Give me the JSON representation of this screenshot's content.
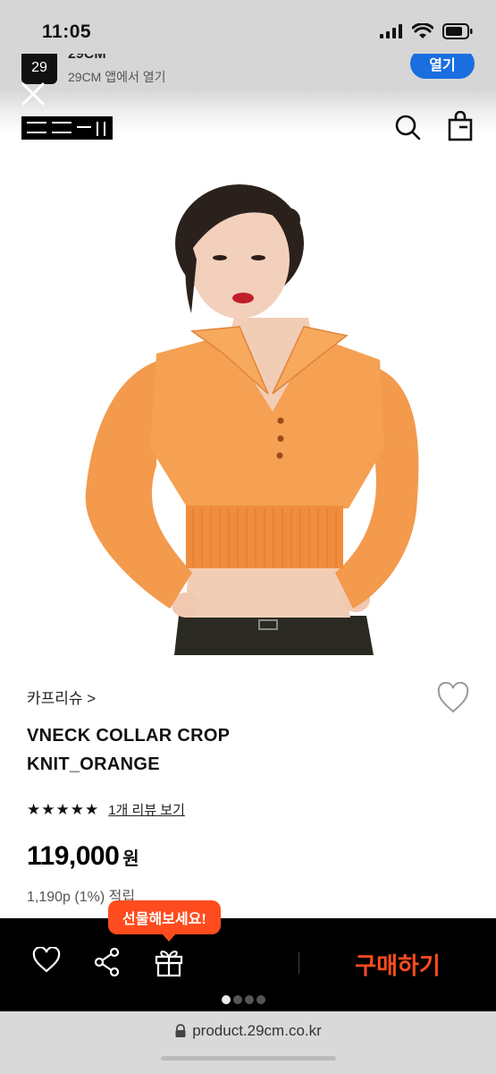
{
  "status_bar": {
    "time": "11:05"
  },
  "app_banner": {
    "logo_text": "29",
    "app_name": "29CM",
    "subtitle": "29CM 앱에서 열기",
    "open_label": "열기"
  },
  "header": {
    "logo": "29CM",
    "icons": [
      "close-icon",
      "search-icon",
      "shopping-bag-icon"
    ]
  },
  "product": {
    "brand": "카프리슈 >",
    "title_line1": "VNECK COLLAR CROP",
    "title_line2": "KNIT_ORANGE",
    "stars": "★★★★★",
    "rating": 5,
    "review_link": "1개 리뷰 보기",
    "price": "119,000",
    "currency": "원",
    "points": "1,190p (1%) 적립",
    "image_colors": {
      "sweater": "#f39a4c",
      "background": "#ffffff"
    }
  },
  "action_bar": {
    "gift_tooltip": "선물해보세요!",
    "buy_label": "구매하기",
    "icons": [
      "heart-icon",
      "share-icon",
      "gift-icon"
    ],
    "accent": "#ff4c1e"
  },
  "page_indicator": {
    "total": 4,
    "active": 1
  },
  "browser": {
    "url": "product.29cm.co.kr"
  }
}
